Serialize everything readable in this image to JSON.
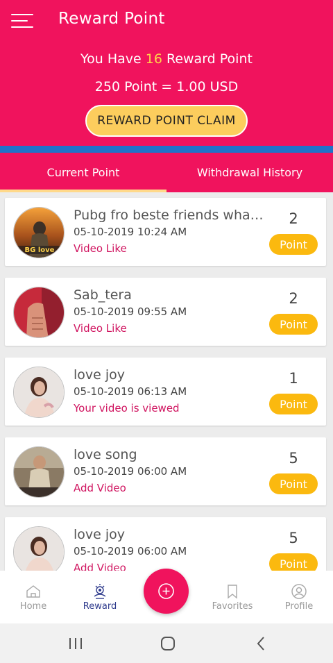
{
  "header": {
    "title": "Reward Point",
    "points_prefix": "You Have ",
    "points_value": "16",
    "points_suffix": " Reward Point",
    "rate": "250 Point = 1.00 USD",
    "claim_label": "REWARD POINT CLAIM"
  },
  "colors": {
    "primary": "#f0135d",
    "accent_blue": "#1f72c9",
    "badge": "#fbb90f",
    "claim_button": "#fccd5d",
    "type_text": "#d01560"
  },
  "tabs": [
    {
      "label": "Current Point",
      "active": true
    },
    {
      "label": "Withdrawal History",
      "active": false
    }
  ],
  "rewards": [
    {
      "title": "Pubg fro beste friends whatsapp",
      "date": "05-10-2019 10:24 AM",
      "type": "Video Like",
      "points": "2",
      "badge": "Point"
    },
    {
      "title": "Sab_tera",
      "date": "05-10-2019 09:55 AM",
      "type": "Video Like",
      "points": "2",
      "badge": "Point"
    },
    {
      "title": "love joy",
      "date": "05-10-2019 06:13 AM",
      "type": "Your video is viewed",
      "points": "1",
      "badge": "Point"
    },
    {
      "title": "love song",
      "date": "05-10-2019 06:00 AM",
      "type": "Add Video",
      "points": "5",
      "badge": "Point"
    },
    {
      "title": "love joy",
      "date": "05-10-2019 06:00 AM",
      "type": "Add Video",
      "points": "5",
      "badge": "Point"
    }
  ],
  "avatar_text": "BG love",
  "bottom_nav": [
    {
      "label": "Home",
      "icon": "home-icon",
      "active": false
    },
    {
      "label": "Reward",
      "icon": "reward-icon",
      "active": true
    },
    {
      "label": "Favorites",
      "icon": "bookmark-icon",
      "active": false
    },
    {
      "label": "Profile",
      "icon": "profile-icon",
      "active": false
    }
  ],
  "fab_icon": "add-circle-icon",
  "system_nav": [
    "recent-apps-icon",
    "home-circle-icon",
    "back-icon"
  ]
}
